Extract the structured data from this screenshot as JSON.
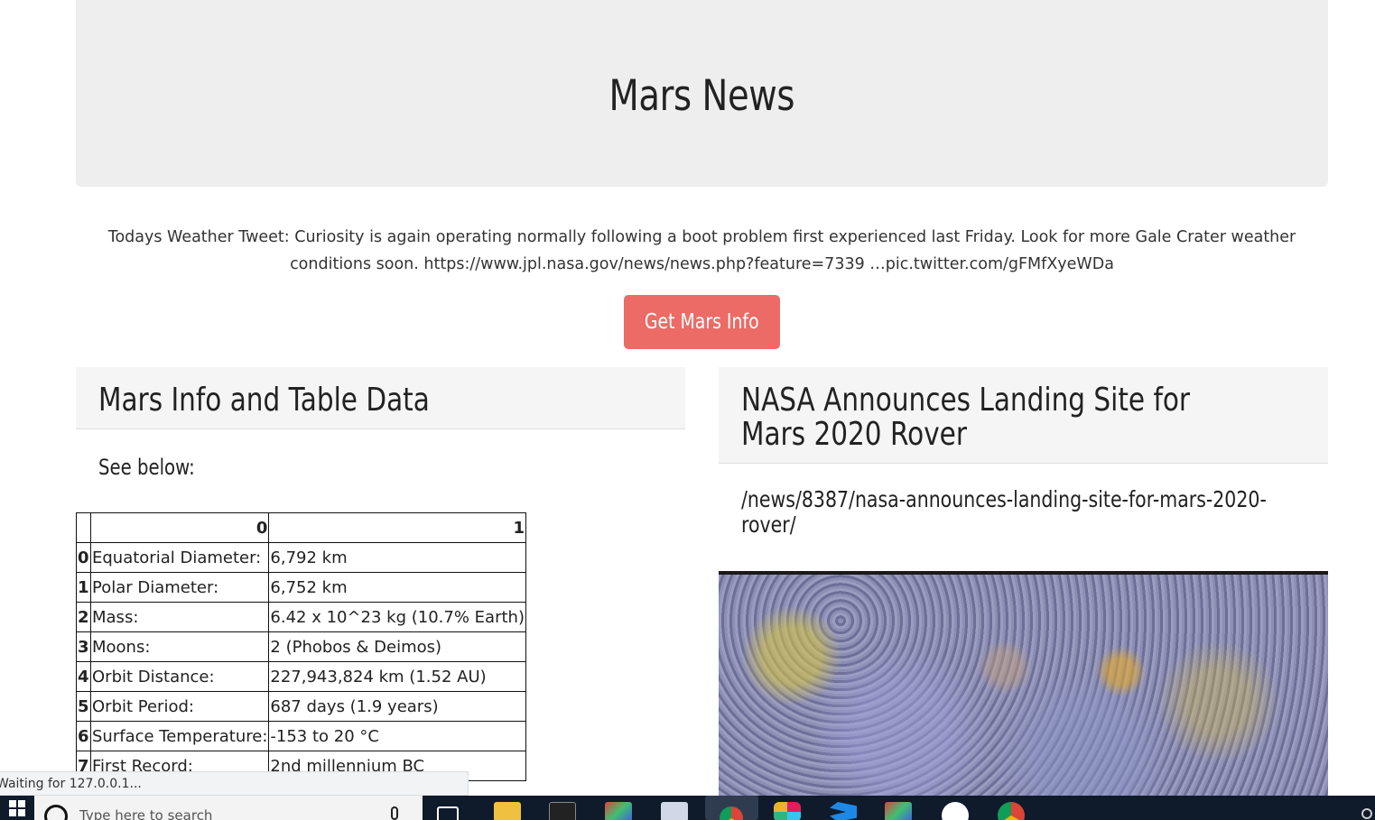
{
  "header": {
    "title": "Mars News"
  },
  "tweet": {
    "text": "Todays Weather Tweet: Curiosity is again operating normally following a boot problem first experienced last Friday. Look for more Gale Crater weather conditions soon. https://www.jpl.nasa.gov/news/news.php?feature=7339 …pic.twitter.com/gFMfXyeWDa"
  },
  "button": {
    "label": "Get Mars Info"
  },
  "left_panel": {
    "title": "Mars Info and Table Data",
    "subtitle": "See below:",
    "table": {
      "columns": [
        "",
        "0",
        "1"
      ],
      "rows": [
        {
          "index": "0",
          "label": "Equatorial Diameter:",
          "value": "6,792 km"
        },
        {
          "index": "1",
          "label": "Polar Diameter:",
          "value": "6,752 km"
        },
        {
          "index": "2",
          "label": "Mass:",
          "value": "6.42 x 10^23 kg (10.7% Earth)"
        },
        {
          "index": "3",
          "label": "Moons:",
          "value": "2 (Phobos & Deimos)"
        },
        {
          "index": "4",
          "label": "Orbit Distance:",
          "value": "227,943,824 km (1.52 AU)"
        },
        {
          "index": "5",
          "label": "Orbit Period:",
          "value": "687 days (1.9 years)"
        },
        {
          "index": "6",
          "label": "Surface Temperature:",
          "value": "-153 to 20 °C"
        },
        {
          "index": "7",
          "label": "First Record:",
          "value": "2nd millennium BC"
        }
      ]
    }
  },
  "right_panel": {
    "title": "NASA Announces Landing Site for Mars 2020 Rover",
    "link": "/news/8387/nasa-announces-landing-site-for-mars-2020-rover/"
  },
  "status_bar": {
    "text": "Waiting for 127.0.0.1..."
  },
  "taskbar": {
    "search_placeholder": "Type here to search",
    "icons": [
      "windows-start-icon",
      "task-view-icon",
      "file-explorer-icon",
      "terminal-icon",
      "git-kraken-icon",
      "remote-desktop-icon",
      "chrome-icon",
      "slack-icon",
      "vscode-icon",
      "git-kraken-icon",
      "mongodb-compass-icon",
      "chrome-icon"
    ],
    "colors": {
      "bg": "#0f1a2b"
    }
  },
  "colors": {
    "button": "#ec6b66",
    "jumbotron": "#eeeeee",
    "panel_heading": "#f5f5f5"
  }
}
